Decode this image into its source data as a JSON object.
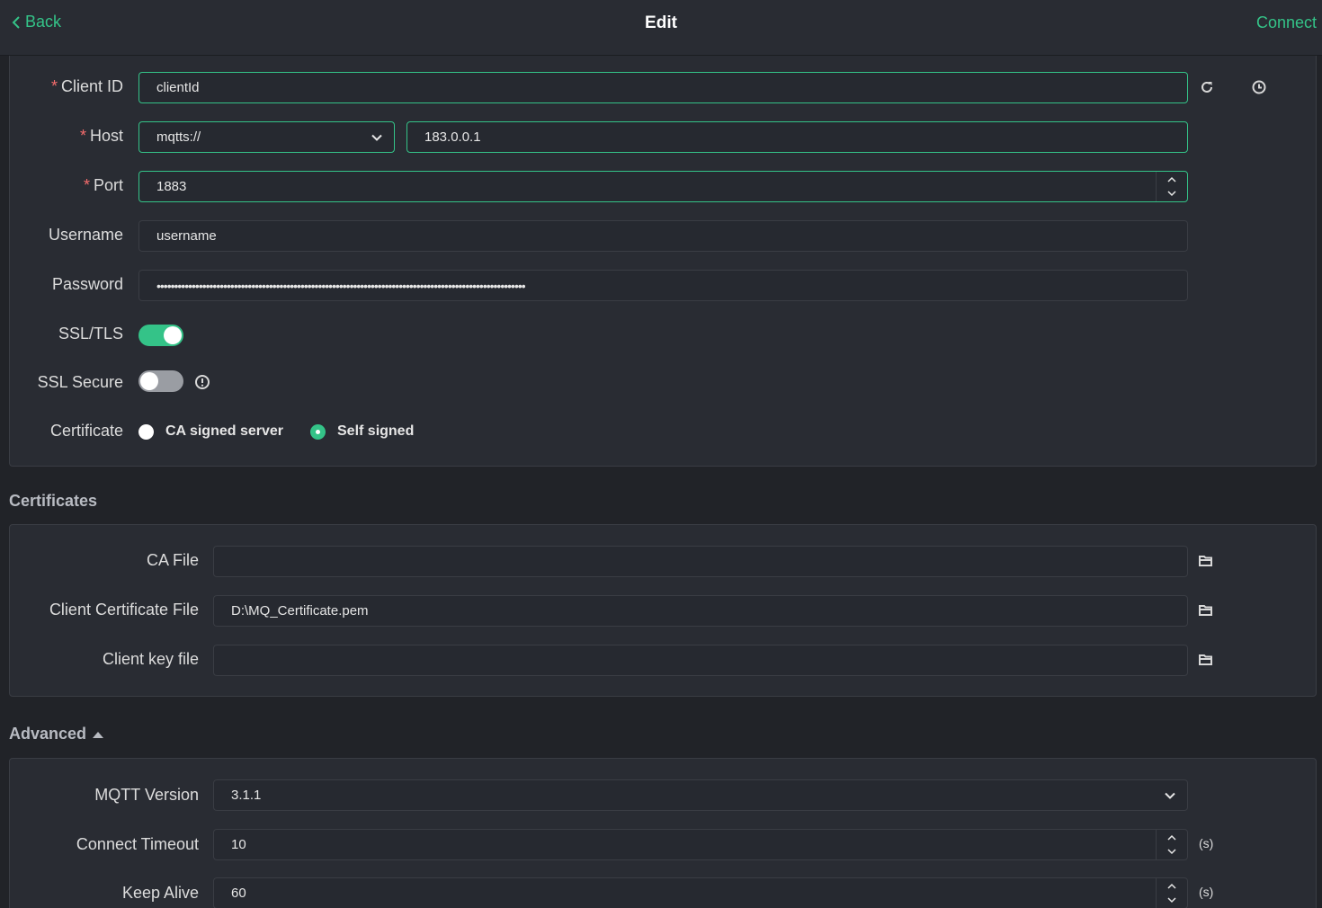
{
  "header": {
    "back_label": "Back",
    "title": "Edit",
    "connect_label": "Connect"
  },
  "general": {
    "client_id": {
      "label": "Client ID",
      "value": "clientId"
    },
    "host": {
      "label": "Host",
      "protocol": "mqtts://",
      "value": "183.0.0.1"
    },
    "port": {
      "label": "Port",
      "value": "1883"
    },
    "username": {
      "label": "Username",
      "value": "username"
    },
    "password": {
      "label": "Password",
      "value": "•••••••••••••••••••••••••••••••••••••••••••••••••••••••••••••••••••••••••••••••••••••••••••••••••••••••••"
    },
    "ssl_tls": {
      "label": "SSL/TLS",
      "on": true
    },
    "ssl_secure": {
      "label": "SSL Secure",
      "on": false
    },
    "certificate": {
      "label": "Certificate",
      "options": [
        "CA signed server",
        "Self signed"
      ],
      "selected": "Self signed"
    },
    "required_mark": "*"
  },
  "certificates": {
    "title": "Certificates",
    "ca_file": {
      "label": "CA File",
      "value": ""
    },
    "client_cert": {
      "label": "Client Certificate File",
      "value": "D:\\MQ_Certificate.pem"
    },
    "client_key": {
      "label": "Client key file",
      "value": ""
    }
  },
  "advanced": {
    "title": "Advanced",
    "mqtt_version": {
      "label": "MQTT Version",
      "value": "3.1.1"
    },
    "connect_timeout": {
      "label": "Connect Timeout",
      "value": "10",
      "unit": "(s)"
    },
    "keep_alive": {
      "label": "Keep Alive",
      "value": "60",
      "unit": "(s)"
    }
  },
  "colors": {
    "accent": "#34c388",
    "background": "#212328",
    "panel": "#292c33",
    "required": "#f56c6c"
  }
}
